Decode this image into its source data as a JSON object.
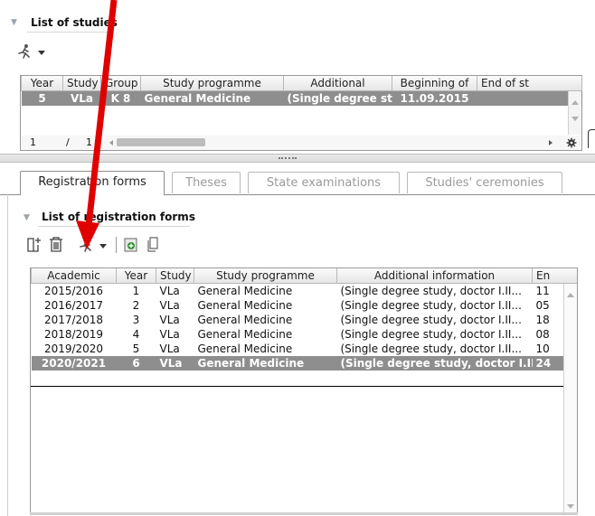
{
  "top_section": {
    "title": "List of studies",
    "columns": [
      "Year",
      "Study",
      "Group",
      "Study programme",
      "Additional",
      "Beginning of",
      "End of st"
    ],
    "rows": [
      {
        "year": "5",
        "study": "VLa",
        "group": "K 8",
        "programme": "General Medicine",
        "additional": "(Single degree st...",
        "beginning": "11.09.2015",
        "end": ""
      }
    ],
    "pager": {
      "current": "1",
      "separator": "/",
      "total": "1"
    }
  },
  "tabs": [
    "Registration forms",
    "Theses",
    "State examinations",
    "Studies' ceremonies"
  ],
  "forms_section": {
    "title": "List of registration forms",
    "columns": [
      "Academic",
      "Year",
      "Study",
      "Study programme",
      "Additional information",
      "En"
    ],
    "rows": [
      {
        "academic": "2015/2016",
        "year": "1",
        "study": "VLa",
        "programme": "General Medicine",
        "info": "(Single degree study, doctor I.II...",
        "en": "11"
      },
      {
        "academic": "2016/2017",
        "year": "2",
        "study": "VLa",
        "programme": "General Medicine",
        "info": "(Single degree study, doctor I.II...",
        "en": "05"
      },
      {
        "academic": "2017/2018",
        "year": "3",
        "study": "VLa",
        "programme": "General Medicine",
        "info": "(Single degree study, doctor I.II...",
        "en": "18"
      },
      {
        "academic": "2018/2019",
        "year": "4",
        "study": "VLa",
        "programme": "General Medicine",
        "info": "(Single degree study, doctor I.II...",
        "en": "08"
      },
      {
        "academic": "2019/2020",
        "year": "5",
        "study": "VLa",
        "programme": "General Medicine",
        "info": "(Single degree study, doctor I.II...",
        "en": "10"
      },
      {
        "academic": "2020/2021",
        "year": "6",
        "study": "VLa",
        "programme": "General Medicine",
        "info": "(Single degree study, doctor I.II...",
        "en": "24"
      }
    ],
    "selected_row": 5
  },
  "icons": {
    "run": "running-person-icon",
    "new": "new-document-icon",
    "delete": "trash-icon",
    "print": "printer-icon",
    "copy": "copy-icon",
    "gear": "gear-icon"
  },
  "colors": {
    "selected_row": "#8e8e8e",
    "annotation_arrow": "#e00000"
  }
}
